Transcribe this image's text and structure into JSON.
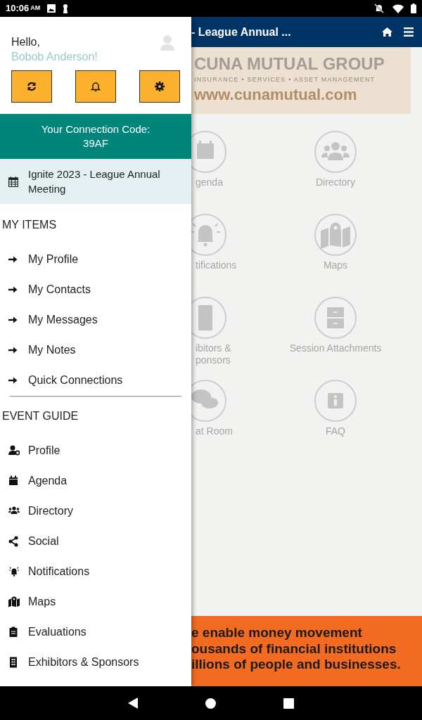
{
  "status_bar": {
    "time": "10:06",
    "ampm": "AM"
  },
  "drawer": {
    "greeting": "Hello,",
    "user_name": "Bobob Anderson!",
    "connection_code": {
      "label": "Your Connection Code:",
      "code": "39AF"
    },
    "event": {
      "title": "Ignite 2023 - League Annual Meeting",
      "selected": true
    },
    "sections": [
      {
        "title": "MY ITEMS",
        "items": [
          "My Profile",
          "My Contacts",
          "My Messages",
          "My Notes",
          "Quick Connections"
        ]
      },
      {
        "title": "EVENT GUIDE",
        "items": [
          "Profile",
          "Agenda",
          "Directory",
          "Social",
          "Notifications",
          "Maps",
          "Evaluations",
          "Exhibitors & Sponsors"
        ]
      }
    ]
  },
  "main": {
    "title": "- League Annual ...",
    "banner": {
      "line_1": "CUNA MUTUAL GROUP",
      "line_2": "INSURANCE  •  SERVICES  •  ASSET MANAGEMENT",
      "line_3": "www.cunamutual.com"
    },
    "tiles": [
      {
        "left": [
          "genda"
        ],
        "right": [
          "Directory"
        ]
      },
      {
        "left": [
          "tifications"
        ],
        "right": [
          "Maps"
        ]
      },
      {
        "left": [
          "ibitors &",
          "ponsors"
        ],
        "right": [
          "Session Attachments"
        ]
      },
      {
        "left": [
          "at Room"
        ],
        "right": [
          "FAQ"
        ]
      }
    ],
    "ad": [
      "e enable money movement",
      "ousands of financial institutions",
      "illions of people and businesses."
    ]
  }
}
